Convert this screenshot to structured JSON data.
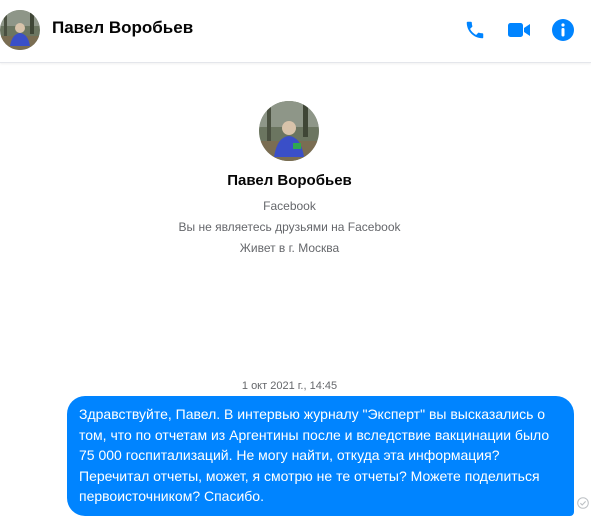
{
  "header": {
    "name": "Павел Воробьев",
    "actions": [
      "phone-icon",
      "video-camera-icon",
      "info-icon"
    ]
  },
  "profile": {
    "name": "Павел Воробьев",
    "platform": "Facebook",
    "friend_status": "Вы не являетесь друзьями на Facebook",
    "location": "Живет в г. Москва"
  },
  "conversation": {
    "timestamp": "1 окт 2021 г., 14:45",
    "messages": [
      {
        "text": "Здравствуйте, Павел. В интервью журналу \"Эксперт\" вы высказались о том, что по отчетам из Аргентины после и вследствие вакцинации было 75 000 госпитализаций. Не могу найти, откуда эта информация? Перечитал отчеты, может, я смотрю не те отчеты? Можете поделиться первоисточником? Спасибо.",
        "sender": "self",
        "status": "sent-check-icon"
      }
    ]
  },
  "colors": {
    "accent": "#0084ff",
    "icon": "#0084ff",
    "secondary_text": "#65676b"
  }
}
